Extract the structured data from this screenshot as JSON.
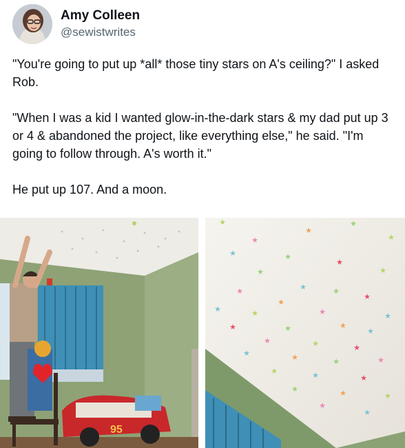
{
  "author": {
    "display_name": "Amy Colleen",
    "handle": "@sewistwrites",
    "avatar_icon": "profile-photo"
  },
  "tweet": {
    "paragraphs": [
      "\"You're going to put up *all* those tiny stars on A's ceiling?\" I asked Rob.",
      "\"When I was a kid I wanted glow-in-the-dark stars & my dad put up 3 or 4 & abandoned the project, like everything else,\" he said. \"I'm going to follow through. A's worth it.\"",
      "He put up 107. And a moon."
    ]
  },
  "media": {
    "photos": [
      {
        "description_icon": "bedroom-ceiling-photo"
      },
      {
        "description_icon": "star-ceiling-photo"
      }
    ]
  },
  "colors": {
    "handle": "#536471",
    "text": "#0f1419",
    "wall_green": "#7f9a6a",
    "ceiling": "#f3f1ec",
    "curtain": "#3f8fb6"
  }
}
